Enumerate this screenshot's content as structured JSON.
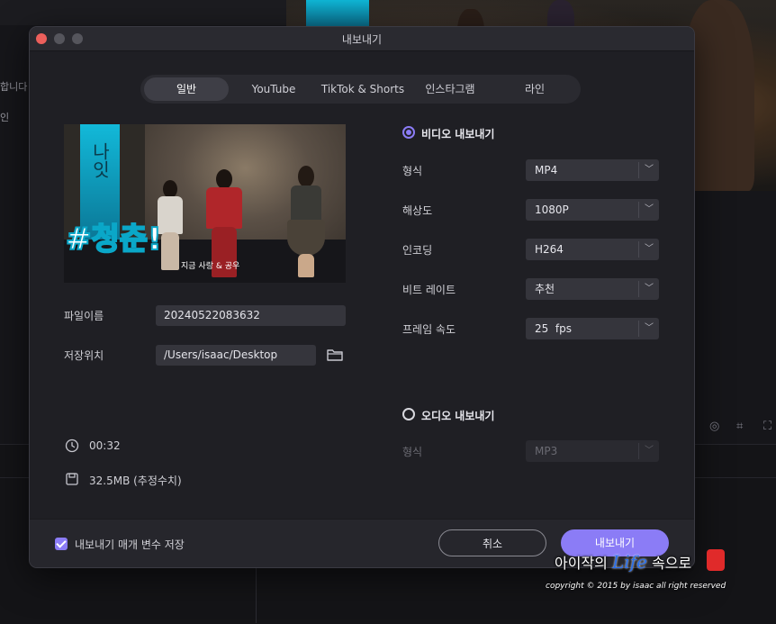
{
  "background": {
    "left_texts": [
      "합니다",
      "인"
    ]
  },
  "dialog": {
    "title": "내보내기",
    "tabs": [
      {
        "label": "일반",
        "active": true
      },
      {
        "label": "YouTube",
        "active": false
      },
      {
        "label": "TikTok & Shorts",
        "active": false
      },
      {
        "label": "인스타그램",
        "active": false
      },
      {
        "label": "라인",
        "active": false
      }
    ],
    "preview": {
      "hashtag": "#청춘!",
      "caption": "지금 사랑 & 공우",
      "banner_text": "나잇"
    },
    "file": {
      "name_label": "파일이름",
      "name_value": "20240522083632",
      "location_label": "저장위치",
      "location_value": "/Users/isaac/Desktop"
    },
    "info": {
      "duration": "00:32",
      "size": "32.5MB (추정수치)"
    },
    "video": {
      "title": "비디오 내보내기",
      "selected": true,
      "rows": [
        {
          "label": "형식",
          "value": "MP4"
        },
        {
          "label": "해상도",
          "value": "1080P"
        },
        {
          "label": "인코딩",
          "value": "H264"
        },
        {
          "label": "비트 레이트",
          "value": "추천"
        },
        {
          "label": "프레임 속도",
          "value": "25  fps"
        }
      ]
    },
    "audio": {
      "title": "오디오 내보내기",
      "selected": false,
      "format_label": "형식",
      "format_value": "MP3"
    },
    "footer": {
      "save_params_label": "내보내기 매개 변수 저장",
      "save_params_checked": true,
      "cancel_label": "취소",
      "export_label": "내보내기"
    }
  },
  "watermark": {
    "prefix": "아이작의",
    "life": "Life",
    "suffix": "속으로",
    "copyright": "copyright © 2015 by isaac all right reserved"
  },
  "colors": {
    "accent": "#8b7cf6",
    "dialog_bg": "#1f1f24",
    "field_bg": "#35353c"
  }
}
